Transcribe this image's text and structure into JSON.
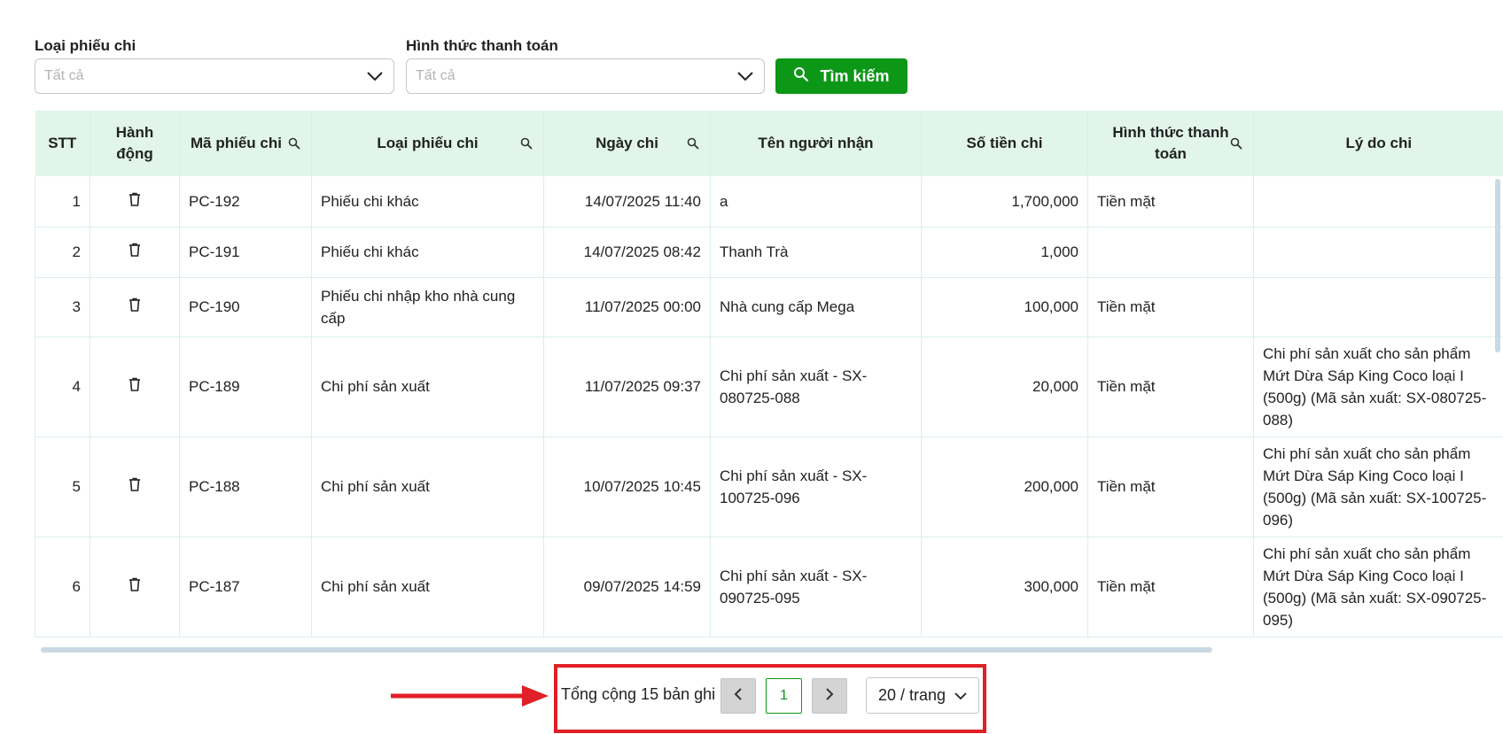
{
  "filters": {
    "expense_type": {
      "label": "Loại phiếu chi",
      "placeholder": "Tất cả"
    },
    "payment_method": {
      "label": "Hình thức thanh toán",
      "placeholder": "Tất cả"
    },
    "search_label": "Tìm kiếm"
  },
  "table": {
    "headers": {
      "stt": "STT",
      "action": "Hành động",
      "code": "Mã phiếu chi",
      "type": "Loại phiếu chi",
      "date": "Ngày chi",
      "recipient": "Tên người nhận",
      "amount": "Số tiền chi",
      "payment": "Hình thức thanh toán",
      "reason": "Lý do chi"
    },
    "rows": [
      {
        "stt": "1",
        "code": "PC-192",
        "type": "Phiếu chi khác",
        "date": "14/07/2025 11:40",
        "recipient": "a",
        "amount": "1,700,000",
        "payment": "Tiền mặt",
        "reason": ""
      },
      {
        "stt": "2",
        "code": "PC-191",
        "type": "Phiếu chi khác",
        "date": "14/07/2025 08:42",
        "recipient": "Thanh Trà",
        "amount": "1,000",
        "payment": "",
        "reason": ""
      },
      {
        "stt": "3",
        "code": "PC-190",
        "type": "Phiếu chi nhập kho nhà cung cấp",
        "date": "11/07/2025 00:00",
        "recipient": "Nhà cung cấp Mega",
        "amount": "100,000",
        "payment": "Tiền mặt",
        "reason": ""
      },
      {
        "stt": "4",
        "code": "PC-189",
        "type": "Chi phí sản xuất",
        "date": "11/07/2025 09:37",
        "recipient": "Chi phí sản xuất - SX-080725-088",
        "amount": "20,000",
        "payment": "Tiền mặt",
        "reason": "Chi phí sản xuất cho sản phẩm Mứt Dừa Sáp King Coco loại I (500g) (Mã sản xuất: SX-080725-088)"
      },
      {
        "stt": "5",
        "code": "PC-188",
        "type": "Chi phí sản xuất",
        "date": "10/07/2025 10:45",
        "recipient": "Chi phí sản xuất - SX-100725-096",
        "amount": "200,000",
        "payment": "Tiền mặt",
        "reason": "Chi phí sản xuất cho sản phẩm Mứt Dừa Sáp King Coco loại I (500g) (Mã sản xuất: SX-100725-096)"
      },
      {
        "stt": "6",
        "code": "PC-187",
        "type": "Chi phí sản xuất",
        "date": "09/07/2025 14:59",
        "recipient": "Chi phí sản xuất - SX-090725-095",
        "amount": "300,000",
        "payment": "Tiền mặt",
        "reason": "Chi phí sản xuất cho sản phẩm Mứt Dừa Sáp King Coco loại I (500g) (Mã sản xuất: SX-090725-095)"
      }
    ]
  },
  "pagination": {
    "total_text": "Tổng cộng 15 bản ghi",
    "current_page": "1",
    "page_size": "20 / trang"
  },
  "icons": {
    "search": "search-icon",
    "delete": "trash-icon",
    "dropdown": "chevron-down-icon",
    "prev": "chevron-left-icon",
    "next": "chevron-right-icon"
  },
  "colors": {
    "primary": "#0d9717",
    "header_bg": "#e1f5ea",
    "annotation": "#e01f26"
  }
}
